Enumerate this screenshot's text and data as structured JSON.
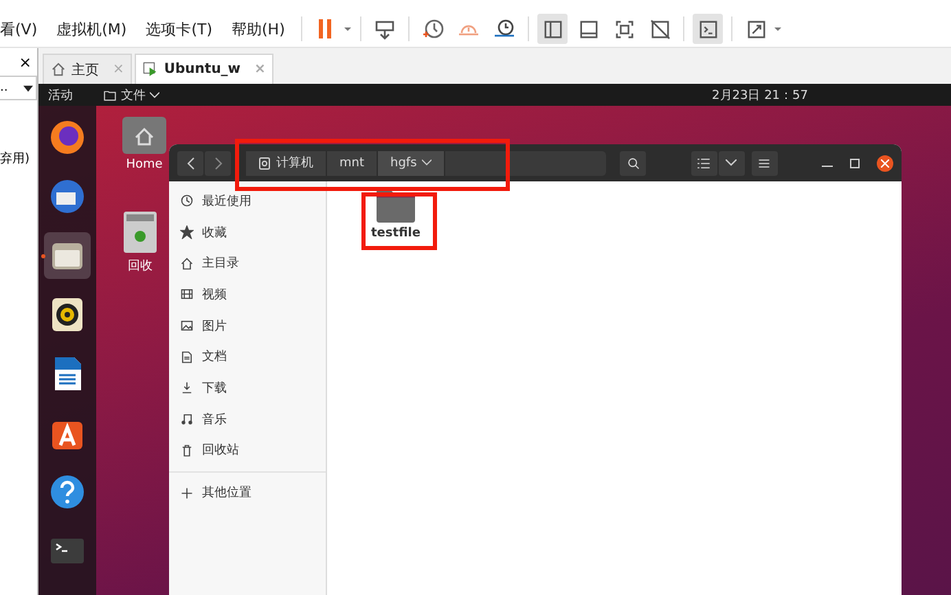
{
  "menu": [
    {
      "label": "看(V)"
    },
    {
      "label": "虚拟机(M)"
    },
    {
      "label": "选项卡(T)"
    },
    {
      "label": "帮助(H)"
    }
  ],
  "side_panel": {
    "close": "×",
    "dropdown": "..",
    "item": "弃用)"
  },
  "tabs": [
    {
      "kind": "home",
      "label": "主页",
      "close": "×",
      "selected": false
    },
    {
      "kind": "vm",
      "label": "Ubuntu_w",
      "close": "×",
      "selected": true
    }
  ],
  "topbar": {
    "activities": "活动",
    "app_menu": "文件",
    "clock": "2月23日 21：57"
  },
  "dock": [
    {
      "kind": "browser",
      "selected": false
    },
    {
      "kind": "mail",
      "selected": false
    },
    {
      "kind": "files",
      "selected": true
    },
    {
      "kind": "audio",
      "selected": false
    },
    {
      "kind": "writer",
      "selected": false
    },
    {
      "kind": "store",
      "selected": false
    },
    {
      "kind": "help",
      "selected": false
    },
    {
      "kind": "terminal",
      "selected": false
    }
  ],
  "desktop_icons": [
    {
      "kind": "home",
      "label": "Home"
    },
    {
      "kind": "trash",
      "label": "回收"
    }
  ],
  "files_window": {
    "path": [
      {
        "kind": "drive",
        "label": "计算机"
      },
      {
        "kind": "folder",
        "label": "mnt"
      },
      {
        "kind": "current",
        "label": "hgfs"
      }
    ],
    "sidebar": [
      {
        "kind": "recent",
        "label": "最近使用"
      },
      {
        "kind": "star",
        "label": "收藏"
      },
      {
        "kind": "home",
        "label": "主目录"
      },
      {
        "kind": "video",
        "label": "视频"
      },
      {
        "kind": "image",
        "label": "图片"
      },
      {
        "kind": "doc",
        "label": "文档"
      },
      {
        "kind": "download",
        "label": "下载"
      },
      {
        "kind": "music",
        "label": "音乐"
      },
      {
        "kind": "trash",
        "label": "回收站"
      },
      {
        "kind": "other",
        "label": "其他位置"
      }
    ],
    "items": [
      {
        "label": "testfile"
      }
    ]
  }
}
